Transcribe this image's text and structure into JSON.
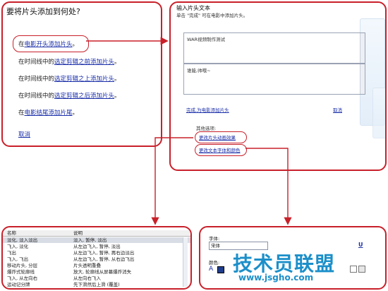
{
  "panel_destination": {
    "title": "要将片头添加到何处?",
    "opt1_prefix": "在",
    "opt1_link": "电影开头添加片头",
    "opt1_suffix": "。",
    "opt2_prefix": "在时间线中的",
    "opt2_link": "选定剪辑之前添加片头",
    "opt2_suffix": "。",
    "opt3_prefix": "在时间线中的",
    "opt3_link": "选定剪辑之上添加片头",
    "opt3_suffix": "。",
    "opt4_prefix": "在时间线中的",
    "opt4_link": "选定剪辑之后添加片头",
    "opt4_suffix": "。",
    "opt5_prefix": "在",
    "opt5_link": "电影结尾添加片尾",
    "opt5_suffix": "。",
    "cancel": "取消"
  },
  "panel_text": {
    "heading": "输入片头文本",
    "subtitle": "单击 \"完成\" 可在电影中添加片头。",
    "text1": "WAR视频制作测试",
    "text2": "谁能,帅哦~",
    "done_link": "完成,为电影添加片头",
    "cancel": "取消",
    "more_options_label": "其他选项:",
    "animation_link": "更改片头动画效果",
    "font_color_link": "更改文本字体和颜色"
  },
  "panel_animation": {
    "columns": [
      "名称",
      "说明"
    ],
    "rows": [
      {
        "name": "淡化, 淡入淡出",
        "desc": "淡入, 暂停, 淡出",
        "selected": true
      },
      {
        "name": "飞入, 淡化",
        "desc": "从左边飞入, 暂停, 淡出",
        "selected": false
      },
      {
        "name": "飞出",
        "desc": "从左边飞入, 暂停, 再右边淡出",
        "selected": false
      },
      {
        "name": "飞入, 飞出",
        "desc": "从左边飞入, 暂停, 从右边飞出",
        "selected": false
      },
      {
        "name": "移动片头, 分层",
        "desc": "片头透明重叠",
        "selected": false
      },
      {
        "name": "爆炸式轮廓线",
        "desc": "放大, 轮廓线从屏幕爆炸消失",
        "selected": false
      },
      {
        "name": "飞入, 从左向右",
        "desc": "从左向右飞入",
        "selected": false
      },
      {
        "name": "运动记分牌",
        "desc": "先下滑然后上滑 (覆盖)",
        "selected": false
      }
    ]
  },
  "panel_font": {
    "font_label": "字体:",
    "font_value": "宋体",
    "color_label": "颜色:",
    "underline": "U"
  },
  "watermark": {
    "brand": "技术员联盟",
    "url": "www.jsgho.com"
  },
  "colors": {
    "callout_red": "#c8202a",
    "link_blue": "#1a2ea8",
    "watermark_blue": "#1c8fc9"
  }
}
